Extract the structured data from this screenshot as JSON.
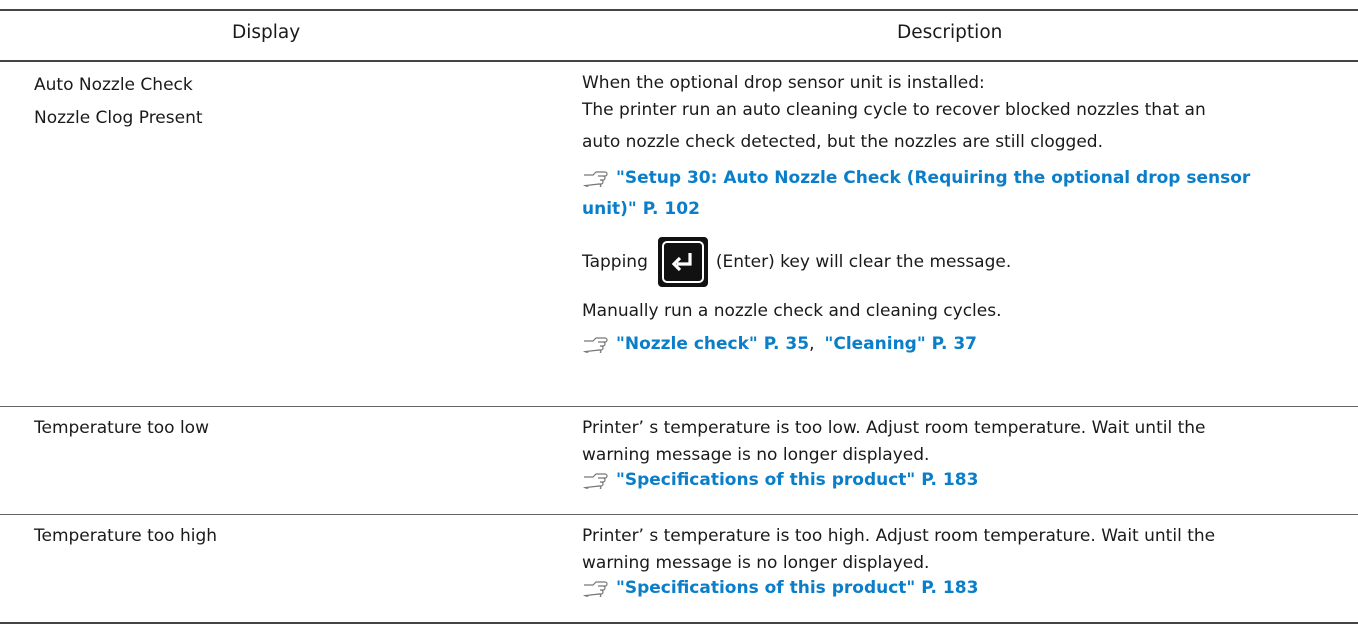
{
  "table": {
    "headers": {
      "display": "Display",
      "description": "Description"
    },
    "rows": [
      {
        "display": [
          "Auto Nozzle Check",
          "Nozzle Clog Present"
        ],
        "desc_line1": "When the optional drop sensor unit is installed:",
        "desc_line2": "The printer run an auto cleaning cycle to recover blocked nozzles that an",
        "desc_line3": "auto nozzle check detected, but the nozzles are still clogged.",
        "ref1_line1": "\"Setup 30: Auto Nozzle Check (Requiring the optional drop sensor",
        "ref1_line2": "unit)\" P. 102",
        "tap_before": "Tapping",
        "tap_after": "(Enter) key will clear the message.",
        "manual": "Manually run a nozzle check and cleaning cycles.",
        "ref2a": "\"Nozzle check\" P. 35",
        "ref2_sep": ",",
        "ref2b": "\"Cleaning\" P. 37"
      },
      {
        "display": "Temperature too low",
        "desc_line1": "Printer’ s temperature is too low. Adjust room temperature. Wait until the",
        "desc_line2": "warning message is no longer displayed.",
        "ref": "\"Specifications of this product\" P. 183"
      },
      {
        "display": "Temperature too high",
        "desc_line1": "Printer’ s temperature is too high. Adjust room temperature. Wait until the",
        "desc_line2": "warning message is no longer displayed.",
        "ref": "\"Specifications of this product\" P. 183"
      }
    ],
    "link_color": "#0a7ec9",
    "icons": [
      "pointing-hand-icon",
      "enter-key-icon"
    ]
  }
}
